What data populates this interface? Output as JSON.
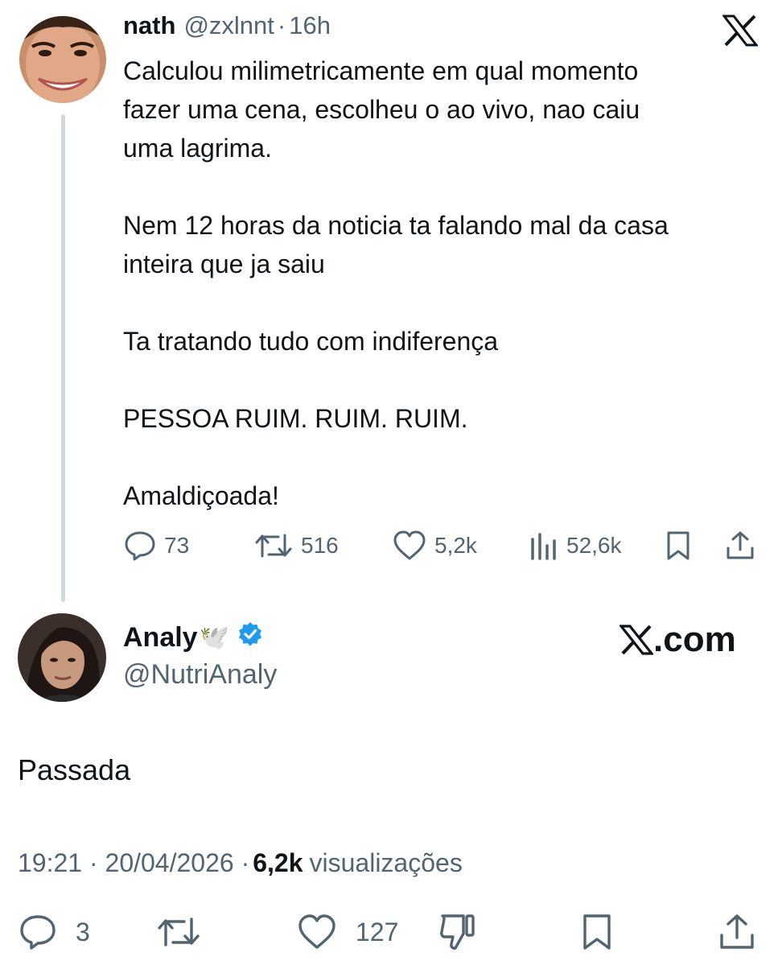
{
  "quoted_tweet": {
    "author_name": "nath",
    "author_handle": "@zxlnnt",
    "separator": "·",
    "time_ago": "16h",
    "logo_icon": "x-logo-icon",
    "body_lines": [
      "Calculou milimetricamente em qual momento",
      "fazer uma cena, escolheu o ao vivo, nao caiu",
      "uma lagrima.",
      "",
      "Nem 12 horas da noticia ta falando mal da casa",
      "inteira que ja saiu",
      "",
      "Ta tratando tudo com indiferença",
      "",
      "PESSOA RUIM. RUIM. RUIM.",
      "",
      "Amaldiçoada!"
    ],
    "metrics": {
      "replies": "73",
      "reposts": "516",
      "likes": "5,2k",
      "views": "52,6k"
    }
  },
  "reply_tweet": {
    "author_name": "Analy",
    "name_emoji": "🕊️",
    "verified": true,
    "verified_color": "#1d9bf0",
    "author_handle": "@NutriAnaly",
    "watermark": ".com",
    "text": "Passada",
    "timestamp": "19:21 · 20/04/2026 ·",
    "views_count": "6,2k",
    "views_label": "visualizações",
    "metrics": {
      "replies": "3",
      "likes": "127"
    }
  },
  "colors": {
    "text_primary": "#0f1419",
    "text_secondary": "#536471",
    "thread_line": "#cfd9de",
    "verified_blue": "#1d9bf0"
  }
}
